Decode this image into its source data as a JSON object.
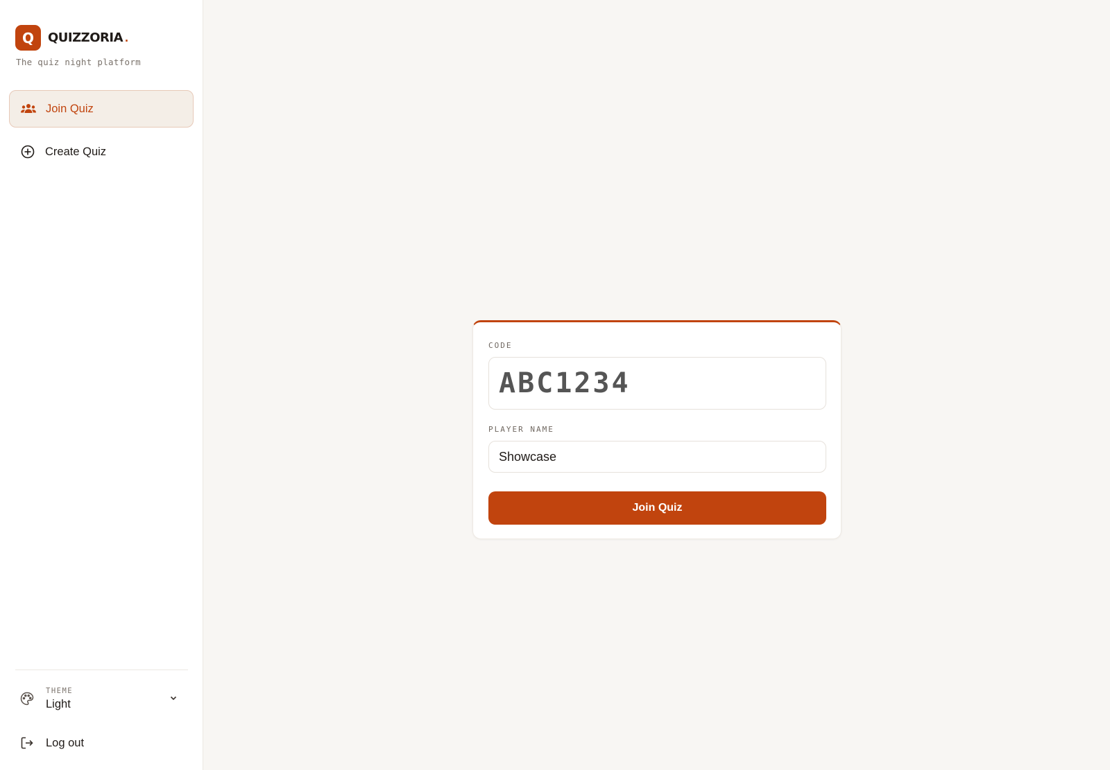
{
  "brand": {
    "logo_letter": "Q",
    "name": "QUIZZORIA",
    "dot": ".",
    "tagline": "The quiz night platform"
  },
  "nav": {
    "items": [
      {
        "label": "Join Quiz",
        "icon": "users-icon",
        "active": true
      },
      {
        "label": "Create Quiz",
        "icon": "plus-circle-icon",
        "active": false
      }
    ]
  },
  "theme": {
    "caption": "THEME",
    "value": "Light",
    "icon": "palette-icon"
  },
  "logout": {
    "label": "Log out",
    "icon": "logout-icon"
  },
  "join_form": {
    "code_label": "CODE",
    "code_placeholder": "ABC1234",
    "code_value": "",
    "name_label": "PLAYER NAME",
    "name_value": "Showcase",
    "submit_label": "Join Quiz"
  },
  "colors": {
    "accent": "#c1440e",
    "active_bg": "#f4eee7",
    "page_bg": "#f8f6f3"
  }
}
